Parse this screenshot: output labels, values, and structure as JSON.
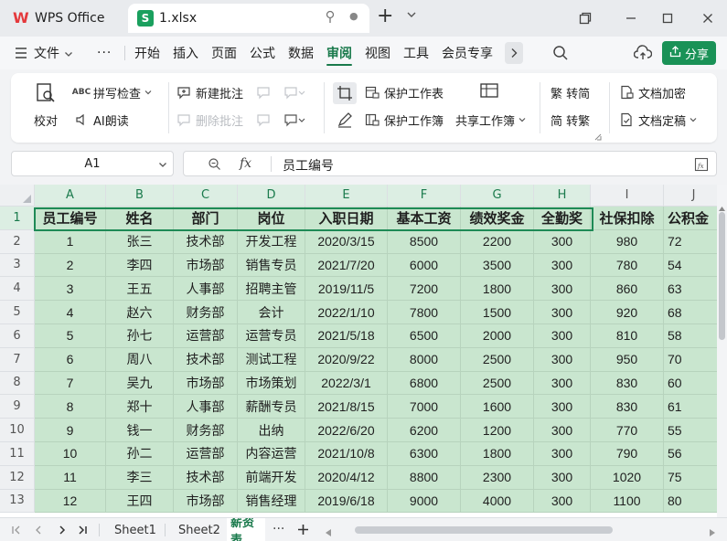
{
  "titlebar": {
    "app_tab": "WPS Office",
    "app_logo": "W",
    "file_tab": "1.xlsx",
    "file_logo": "S",
    "new_tab": "+",
    "status_dot": "●"
  },
  "menubar": {
    "file": "文件",
    "more": "···",
    "items": [
      "开始",
      "插入",
      "页面",
      "公式",
      "数据",
      "审阅",
      "视图",
      "工具",
      "会员专享"
    ],
    "active": "审阅",
    "share": "分享"
  },
  "ribbon": {
    "proofread": "校对",
    "spellcheck": "拼写检查",
    "ai_read": "AI朗读",
    "new_comment": "新建批注",
    "delete_comment": "删除批注",
    "protect_sheet": "保护工作表",
    "protect_book": "保护工作簿",
    "share_book": "共享工作簿",
    "trad_to_simp": "繁 转简",
    "simp_to_trad": "简 转繁",
    "doc_encrypt": "文档加密",
    "doc_finalize": "文档定稿"
  },
  "formula": {
    "cell_ref": "A1",
    "fx": "fx",
    "content": "员工编号"
  },
  "columns": [
    "A",
    "B",
    "C",
    "D",
    "E",
    "F",
    "G",
    "H",
    "I",
    "J"
  ],
  "rows": [
    "1",
    "2",
    "3",
    "4",
    "5",
    "6",
    "7",
    "8",
    "9",
    "10",
    "11",
    "12",
    "13"
  ],
  "header_row": [
    "员工编号",
    "姓名",
    "部门",
    "岗位",
    "入职日期",
    "基本工资",
    "绩效奖金",
    "全勤奖",
    "社保扣除",
    "公积金"
  ],
  "data_rows": [
    [
      "1",
      "张三",
      "技术部",
      "开发工程",
      "2020/3/15",
      "8500",
      "2200",
      "300",
      "980",
      "72"
    ],
    [
      "2",
      "李四",
      "市场部",
      "销售专员",
      "2021/7/20",
      "6000",
      "3500",
      "300",
      "780",
      "54"
    ],
    [
      "3",
      "王五",
      "人事部",
      "招聘主管",
      "2019/11/5",
      "7200",
      "1800",
      "300",
      "860",
      "63"
    ],
    [
      "4",
      "赵六",
      "财务部",
      "会计",
      "2022/1/10",
      "7800",
      "1500",
      "300",
      "920",
      "68"
    ],
    [
      "5",
      "孙七",
      "运营部",
      "运营专员",
      "2021/5/18",
      "6500",
      "2000",
      "300",
      "810",
      "58"
    ],
    [
      "6",
      "周八",
      "技术部",
      "测试工程",
      "2020/9/22",
      "8000",
      "2500",
      "300",
      "950",
      "70"
    ],
    [
      "7",
      "吴九",
      "市场部",
      "市场策划",
      "2022/3/1",
      "6800",
      "2500",
      "300",
      "830",
      "60"
    ],
    [
      "8",
      "郑十",
      "人事部",
      "薪酬专员",
      "2021/8/15",
      "7000",
      "1600",
      "300",
      "830",
      "61"
    ],
    [
      "9",
      "钱一",
      "财务部",
      "出纳",
      "2022/6/20",
      "6200",
      "1200",
      "300",
      "770",
      "55"
    ],
    [
      "10",
      "孙二",
      "运营部",
      "内容运营",
      "2021/10/8",
      "6300",
      "1800",
      "300",
      "790",
      "56"
    ],
    [
      "11",
      "李三",
      "技术部",
      "前端开发",
      "2020/4/12",
      "8800",
      "2300",
      "300",
      "1020",
      "75"
    ],
    [
      "12",
      "王四",
      "市场部",
      "销售经理",
      "2019/6/18",
      "9000",
      "4000",
      "300",
      "1100",
      "80"
    ]
  ],
  "sheets": [
    "Sheet1",
    "Sheet2",
    "薪资表"
  ],
  "active_sheet": "薪资表",
  "colors": {
    "accent": "#1a7a4c",
    "cell_fill": "#c9e6cf"
  }
}
